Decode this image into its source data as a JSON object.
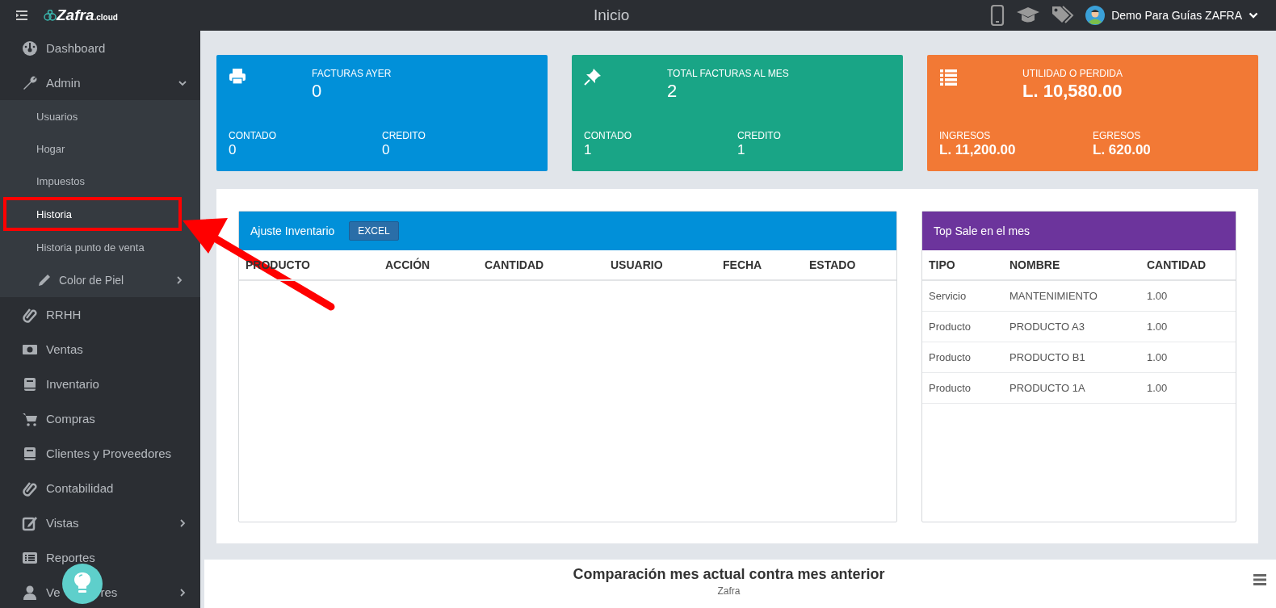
{
  "topbar": {
    "logo": "Zafra",
    "logo_suffix": ".cloud",
    "title": "Inicio",
    "user": "Demo Para Guías ZAFRA"
  },
  "sidebar": {
    "items": [
      {
        "label": "Dashboard",
        "expandable": false
      },
      {
        "label": "Admin",
        "expandable": true,
        "expanded": true,
        "children": [
          {
            "label": "Usuarios",
            "highlighted": false
          },
          {
            "label": "Hogar",
            "highlighted": false
          },
          {
            "label": "Impuestos",
            "highlighted": false
          },
          {
            "label": "Historia",
            "highlighted": true
          },
          {
            "label": "Historia punto de venta",
            "highlighted": false
          },
          {
            "label": "Color de Piel",
            "highlighted": false,
            "expandable": true,
            "expanded": false
          }
        ]
      },
      {
        "label": "RRHH",
        "expandable": false
      },
      {
        "label": "Ventas",
        "expandable": false
      },
      {
        "label": "Inventario",
        "expandable": false
      },
      {
        "label": "Compras",
        "expandable": false
      },
      {
        "label": "Clientes y Proveedores",
        "expandable": false
      },
      {
        "label": "Contabilidad",
        "expandable": false
      },
      {
        "label": "Vistas",
        "expandable": true,
        "expanded": false
      },
      {
        "label": "Reportes",
        "expandable": false
      },
      {
        "label": "Ve",
        "label_tail": "res",
        "expandable": true,
        "expanded": false
      }
    ]
  },
  "cards": [
    {
      "color": "#0190d9",
      "title": "FACTURAS AYER",
      "value": "0",
      "left_label": "CONTADO",
      "left_value": "0",
      "right_label": "CREDITO",
      "right_value": "0"
    },
    {
      "color": "#19a586",
      "title": "TOTAL FACTURAS AL MES",
      "value": "2",
      "left_label": "CONTADO",
      "left_value": "1",
      "right_label": "CREDITO",
      "right_value": "1"
    },
    {
      "color": "#f27935",
      "title": "UTILIDAD O PERDIDA",
      "value": "L. 10,580.00",
      "left_label": "INGRESOS",
      "left_value": "L. 11,200.00",
      "right_label": "EGRESOS",
      "right_value": "L. 620.00"
    }
  ],
  "inventory_panel": {
    "title": "Ajuste Inventario",
    "button": "EXCEL",
    "columns": [
      "PRODUCTO",
      "ACCIÓN",
      "CANTIDAD",
      "USUARIO",
      "FECHA",
      "ESTADO"
    ]
  },
  "top_sale_panel": {
    "title": "Top Sale en el mes",
    "columns": [
      "TIPO",
      "NOMBRE",
      "CANTIDAD"
    ],
    "rows": [
      [
        "Servicio",
        "MANTENIMIENTO",
        "1.00"
      ],
      [
        "Producto",
        "PRODUCTO A3",
        "1.00"
      ],
      [
        "Producto",
        "PRODUCTO B1",
        "1.00"
      ],
      [
        "Producto",
        "PRODUCTO 1A",
        "1.00"
      ]
    ]
  },
  "chart_panel": {
    "title": "Comparación mes actual contra mes anterior",
    "subtitle": "Zafra"
  }
}
